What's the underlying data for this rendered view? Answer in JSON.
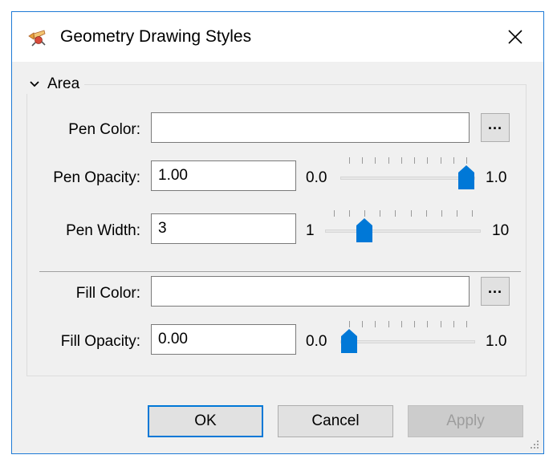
{
  "window": {
    "title": "Geometry Drawing Styles",
    "accent_color": "#0078d7"
  },
  "group": {
    "label": "Area",
    "expanded": true
  },
  "pen_color": {
    "label": "Pen Color:",
    "value": "",
    "picker_label": "..."
  },
  "pen_opacity": {
    "label": "Pen Opacity:",
    "value": "1.00",
    "min_label": "0.0",
    "max_label": "1.0",
    "slider_fraction": 1.0
  },
  "pen_width": {
    "label": "Pen Width:",
    "value": "3",
    "min_label": "1",
    "max_label": "10",
    "slider_fraction": 0.2222
  },
  "fill_color": {
    "label": "Fill Color:",
    "value": "",
    "picker_label": "..."
  },
  "fill_opacity": {
    "label": "Fill Opacity:",
    "value": "0.00",
    "min_label": "0.0",
    "max_label": "1.0",
    "slider_fraction": 0.0
  },
  "buttons": {
    "ok": "OK",
    "cancel": "Cancel",
    "apply": "Apply"
  }
}
